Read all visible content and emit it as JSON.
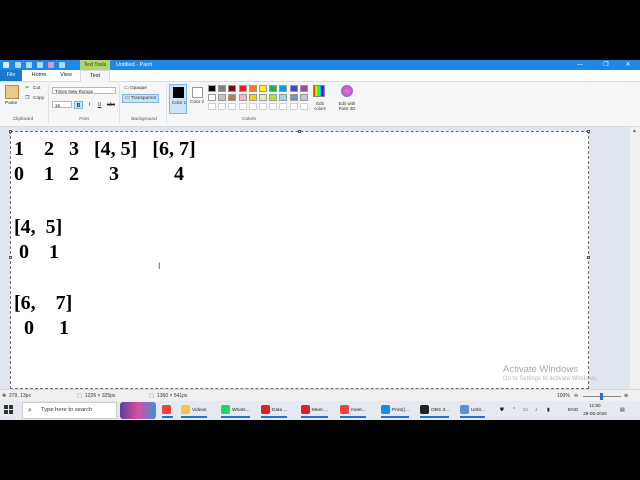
{
  "window": {
    "title": "Untitled - Paint",
    "context_tab": "Text Tools",
    "buttons": [
      "—",
      "❐",
      "✕"
    ]
  },
  "tabs": [
    "File",
    "Home",
    "View",
    "Text"
  ],
  "ribbon": {
    "clipboard": {
      "paste": "Paste",
      "cut": "Cut",
      "copy": "Copy",
      "label": "Clipboard"
    },
    "font": {
      "name": "Times New Roman",
      "size": "16",
      "label": "Font",
      "bold": "B",
      "italic": "I",
      "underline": "U",
      "strike": "abc"
    },
    "background": {
      "opaque": "Opaque",
      "transparent": "Transparent",
      "label": "Background"
    },
    "colors": {
      "color1": "Color 1",
      "color2": "Color 2",
      "edit": "Edit colors",
      "paint3d": "Edit with Paint 3D",
      "label": "Colors",
      "palette_row1": [
        "#000000",
        "#7f7f7f",
        "#880015",
        "#ed1c24",
        "#ff7f27",
        "#fff200",
        "#22b14c",
        "#00a2e8",
        "#3f48cc",
        "#a349a4"
      ],
      "palette_row2": [
        "#ffffff",
        "#c3c3c3",
        "#b97a57",
        "#ffaec9",
        "#ffc90e",
        "#efe4b0",
        "#b5e61d",
        "#99d9ea",
        "#7092be",
        "#c8bfe7"
      ]
    }
  },
  "canvas": {
    "lines": [
      {
        "text": "1    2   3   [4, 5]   [6, 7]"
      },
      {
        "text": "0    1   2      3           4"
      },
      {
        "text": "[4,  5]"
      },
      {
        "text": " 0    1"
      },
      {
        "text": "[6,    7]"
      },
      {
        "text": "  0     1"
      }
    ],
    "watermark_title": "Activate Windows",
    "watermark_sub": "Go to Settings to activate Windows."
  },
  "statusbar": {
    "cursor_pos": "279, 13px",
    "selection_size": "1226 × 325px",
    "image_size": "1360 × 541px",
    "zoom": "100%"
  },
  "taskbar": {
    "search_placeholder": "Type here to search",
    "items": [
      {
        "label": "",
        "icon": "chrome-icon",
        "color": "#e8453c"
      },
      {
        "label": "Videos",
        "icon": "folder-icon",
        "color": "#f4c542"
      },
      {
        "label": "Whats...",
        "icon": "whatsapp-icon",
        "color": "#25d366"
      },
      {
        "label": "Data ...",
        "icon": "wps-icon",
        "color": "#d8232a"
      },
      {
        "label": "Meet ...",
        "icon": "meet-icon",
        "color": "#d8232a"
      },
      {
        "label": "meet...",
        "icon": "chrome-icon",
        "color": "#e8453c"
      },
      {
        "label": "Print()...",
        "icon": "vscode-icon",
        "color": "#1e88e5"
      },
      {
        "label": "OBS 3...",
        "icon": "obs-icon",
        "color": "#222222"
      },
      {
        "label": "Untit...",
        "icon": "paint-icon",
        "color": "#5b8fd6"
      }
    ],
    "lang": "ENG",
    "time": "11:50",
    "date": "29-06-2026"
  }
}
